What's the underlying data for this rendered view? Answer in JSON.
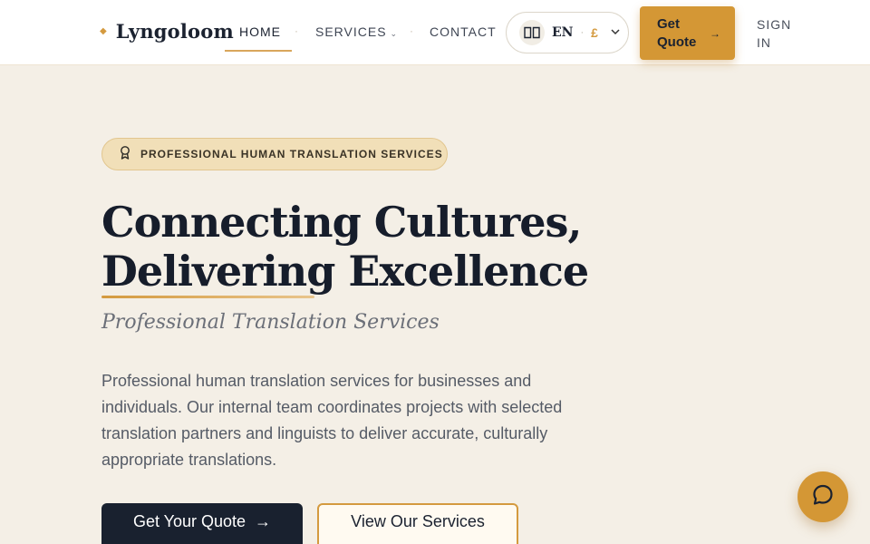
{
  "brand": {
    "name": "Lyngoloom",
    "mark": "◆"
  },
  "nav": {
    "home": "HOME",
    "services": "SERVICES",
    "contact": "CONTACT",
    "separator": "·"
  },
  "locale": {
    "language": "EN",
    "separator": "·",
    "currency": "£",
    "icon": "book-open-icon"
  },
  "header_actions": {
    "quote_label": "Get Quote",
    "quote_arrow": "→",
    "signin_label": "SIGN IN"
  },
  "hero": {
    "badge": "PROFESSIONAL HUMAN TRANSLATION SERVICES",
    "badge_icon": "award-icon",
    "title": "Connecting Cultures, Delivering Excellence",
    "subtitle": "Professional Translation Services",
    "description": "Professional human translation services for businesses and individuals. Our internal team coordinates projects with selected translation partners and linguists to deliver accurate, culturally appropriate translations.",
    "primary_cta": "Get Your Quote",
    "primary_cta_arrow": "→",
    "secondary_cta": "View Our Services"
  },
  "chat": {
    "icon": "chat-bubble-icon"
  },
  "colors": {
    "accent": "#d49735",
    "dark": "#19212f",
    "background": "#f4efe6"
  }
}
